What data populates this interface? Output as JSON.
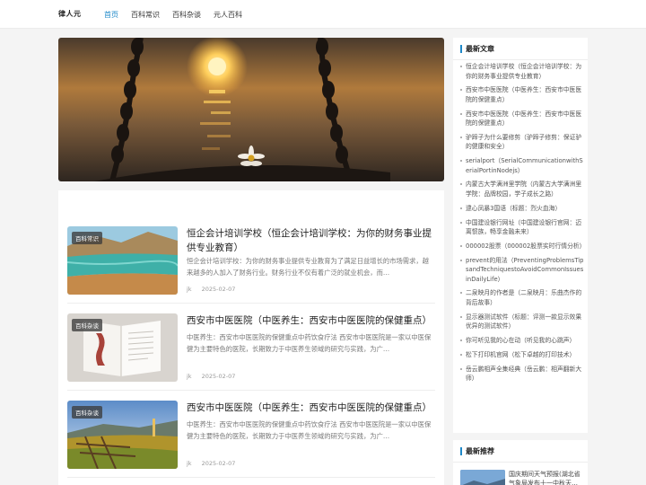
{
  "site": {
    "logo": "律人元"
  },
  "nav": [
    "首页",
    "百科常识",
    "百科杂谈",
    "元人百科"
  ],
  "posts": [
    {
      "tag": "百科常识",
      "title": "恒企会计培训学校（恒企会计培训学校：为你的财务事业提供专业教育）",
      "excerpt": "恒企会计培训学校：为你的财务事业提供专业教育为了满足日益增长的市场需求，越来越多的人加入了财务行业。财务行业不仅有着广泛的就业机会，而…",
      "author": "jk",
      "date": "2025-02-07"
    },
    {
      "tag": "百科杂谈",
      "title": "西安市中医医院（中医养生：西安市中医医院的保健重点）",
      "excerpt": "中医养生：西安市中医医院的保健重点中药饮食疗法 西安市中医医院是一家以中医保健为主要特色的医院，长期致力于中医养生领域的研究与实践，为广…",
      "author": "jk",
      "date": "2025-02-07"
    },
    {
      "tag": "百科杂谈",
      "title": "西安市中医医院（中医养生：西安市中医医院的保健重点）",
      "excerpt": "中医养生：西安市中医医院的保健重点中药饮食疗法 西安市中医医院是一家以中医保健为主要特色的医院，长期致力于中医养生领域的研究与实践，为广…",
      "author": "jk",
      "date": "2025-02-07"
    }
  ],
  "sidebar": {
    "latest_title": "最新文章",
    "latest": [
      "恒企会计培训学校（恒企会计培训学校：为你的财务事业提供专业教育）",
      "西安市中医医院（中医养生：西安市中医医院的保健重点）",
      "西安市中医医院（中医养生：西安市中医医院的保健重点）",
      "驴蹄子为什么要修剪（驴蹄子修剪：保证驴的健康和安全）",
      "serialport（SerialCommunicationwithSerialPortinNodejs）",
      "内蒙古大学满洲里学院（内蒙古大学满洲里学院：品牌校园，学子成长之路）",
      "逮心凤暴3国语（标题：烈火血海）",
      "中国建设银行网址（中国建设银行官网：迈离惯族，畅享金融未来）",
      "000002股票（000002股票实时行情分析）",
      "prevent的用法（PreventingProblemsTipsandTechniquestoAvoidCommonIssuesinDailyLife）",
      "二泉映月的作者是（二泉映月：乐曲杰作的背后故事）",
      "显示器测试软件（标题：评测一款显示效果优异的测试软件）",
      "你可听见我的心在动（听见我的心跳声）",
      "松下打印机官网（松下卓越的打印技术）",
      "岳云鹏相声全集经典（岳云鹏：相声翻新大师）"
    ],
    "recommend_title": "最新推荐",
    "recommend_item": "国庆期间天气预报(湖北省气象局发布十一中秋天…"
  }
}
